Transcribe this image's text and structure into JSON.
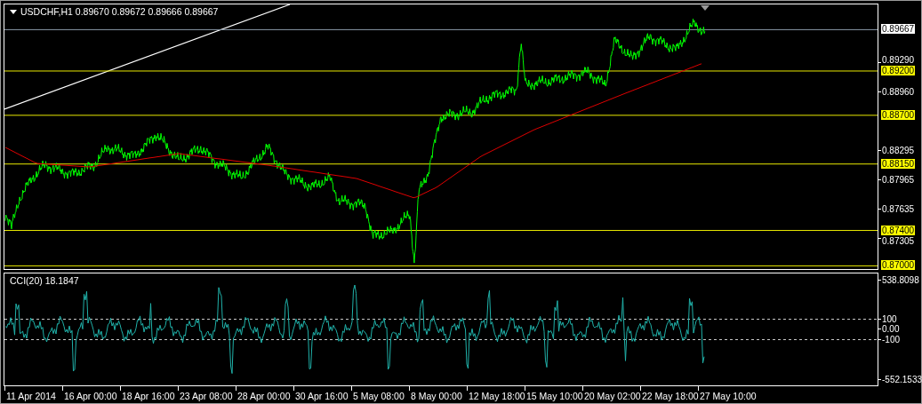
{
  "price_pane": {
    "title": "USDCHF,H1  0.89670 0.89672 0.89666 0.89667",
    "current_price": "0.89667",
    "axis_labels": [
      "0.89290",
      "0.88960",
      "0.88295",
      "0.87965",
      "0.87635",
      "0.87305"
    ],
    "levels": [
      {
        "label": "0.89200"
      },
      {
        "label": "0.88700"
      },
      {
        "label": "0.88150"
      },
      {
        "label": "0.87400"
      },
      {
        "label": "0.87000"
      }
    ]
  },
  "cci_pane": {
    "title": "CCI(20) 18.1847",
    "axis_labels": [
      "538.8098",
      "0.00",
      "-552.1533"
    ],
    "levels": [
      "100",
      "-100"
    ]
  },
  "time_axis": [
    "11 Apr 2014",
    "16 Apr 00:00",
    "18 Apr 16:00",
    "23 Apr 08:00",
    "28 Apr 00:00",
    "30 Apr 16:00",
    "5 May 08:00",
    "8 May 00:00",
    "12 May 18:00",
    "15 May 10:00",
    "20 May 02:00",
    "22 May 18:00",
    "27 May 10:00"
  ]
}
